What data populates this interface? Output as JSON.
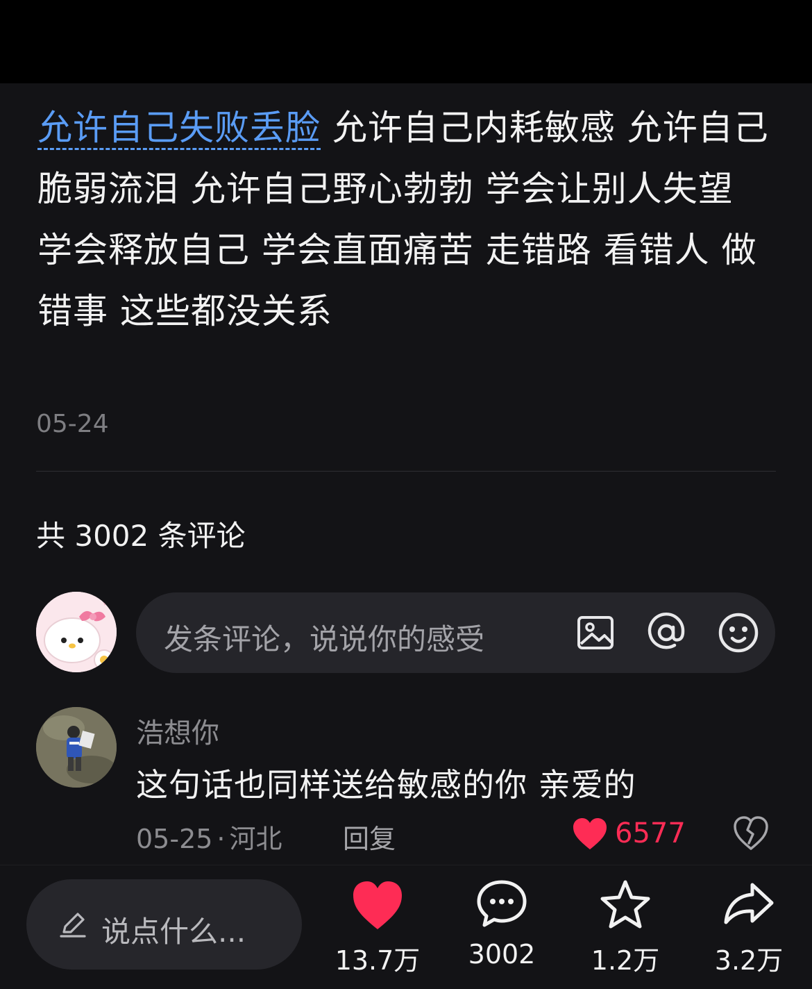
{
  "post": {
    "hashtag": "允许自己失败丢脸",
    "body": " 允许自己内耗敏感 允许自己脆弱流泪 允许自己野心勃勃  学会让别人失望 学会释放自己 学会直面痛苦  走错路 看错人 做错事  这些都没关系",
    "date": "05-24"
  },
  "comments_header": {
    "count_text": "共 3002 条评论"
  },
  "comment_input": {
    "placeholder": "发条评论，说说你的感受"
  },
  "comments": [
    {
      "user": "浩想你",
      "text": "这句话也同样送给敏感的你 亲爱的",
      "date": "05-25",
      "dot": "·",
      "location": "河北",
      "reply_label": "回复",
      "likes": "6577"
    }
  ],
  "bottom_bar": {
    "say_label": "说点什么...",
    "like_count": "13.7万",
    "comment_count": "3002",
    "favorite_count": "1.2万",
    "share_count": "3.2万"
  },
  "colors": {
    "background": "#131316",
    "hashtag": "#5a9cf5",
    "like_red": "#fe2c55"
  },
  "icons": [
    "image-icon",
    "at-icon",
    "emoji-icon",
    "heart-icon",
    "broken-heart-icon",
    "pen-icon",
    "comment-bubble-icon",
    "star-icon",
    "share-arrow-icon"
  ]
}
